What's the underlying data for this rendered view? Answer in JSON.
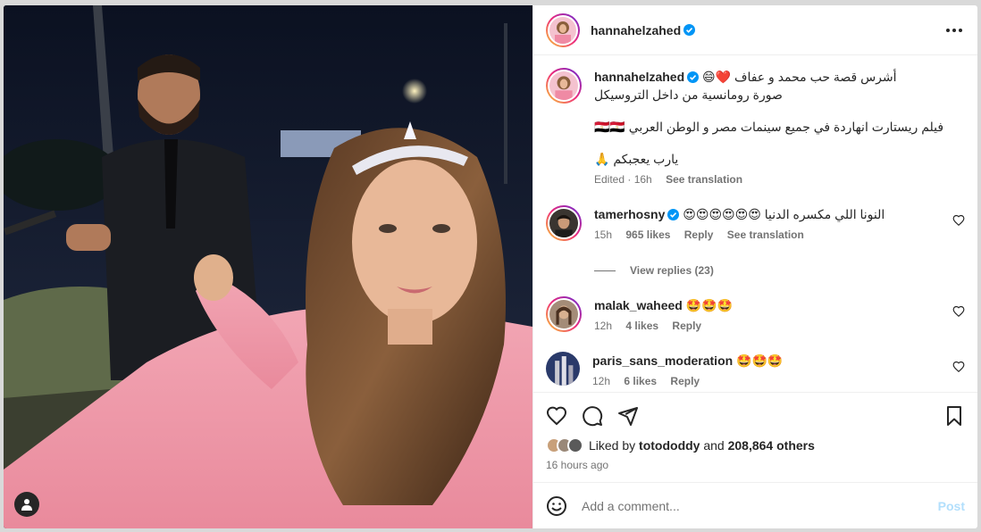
{
  "post": {
    "author": "hannahelzahed",
    "more_icon": "more-horizontal-icon",
    "caption": {
      "line1": "أشرس قصة حب محمد و عفاف ❤️😄",
      "line2": "صورة رومانسية من داخل التروسيكل",
      "line3": "فيلم ريستارت انهاردة في جميع سينمات مصر و الوطن العربي 🇪🇬🇪🇬",
      "line4": "يارب يعجبكم 🙏",
      "edited": "Edited · 16h",
      "see_translation": "See translation"
    },
    "comments": [
      {
        "username": "tamerhosny",
        "verified": true,
        "text": "النونا اللي مكسره الدنيا 😍😍😍😍😍😍",
        "time": "15h",
        "likes": "965 likes",
        "reply": "Reply",
        "see_translation": "See translation",
        "view_replies": "View replies (23)"
      },
      {
        "username": "malak_waheed",
        "verified": false,
        "text": "🤩🤩🤩",
        "time": "12h",
        "likes": "4 likes",
        "reply": "Reply"
      },
      {
        "username": "paris_sans_moderation",
        "verified": false,
        "text": "🤩🤩🤩",
        "time": "12h",
        "likes": "6 likes",
        "reply": "Reply"
      }
    ],
    "liked_by_prefix": "Liked by",
    "liked_by_user": "totododdy",
    "liked_by_and": "and",
    "liked_by_others": "208,864 others",
    "time_ago": "16 hours ago",
    "add_comment_placeholder": "Add a comment...",
    "post_button": "Post"
  },
  "colors": {
    "verified": "#0095f6",
    "muted": "#737373",
    "post_disabled": "#b2dffc"
  }
}
